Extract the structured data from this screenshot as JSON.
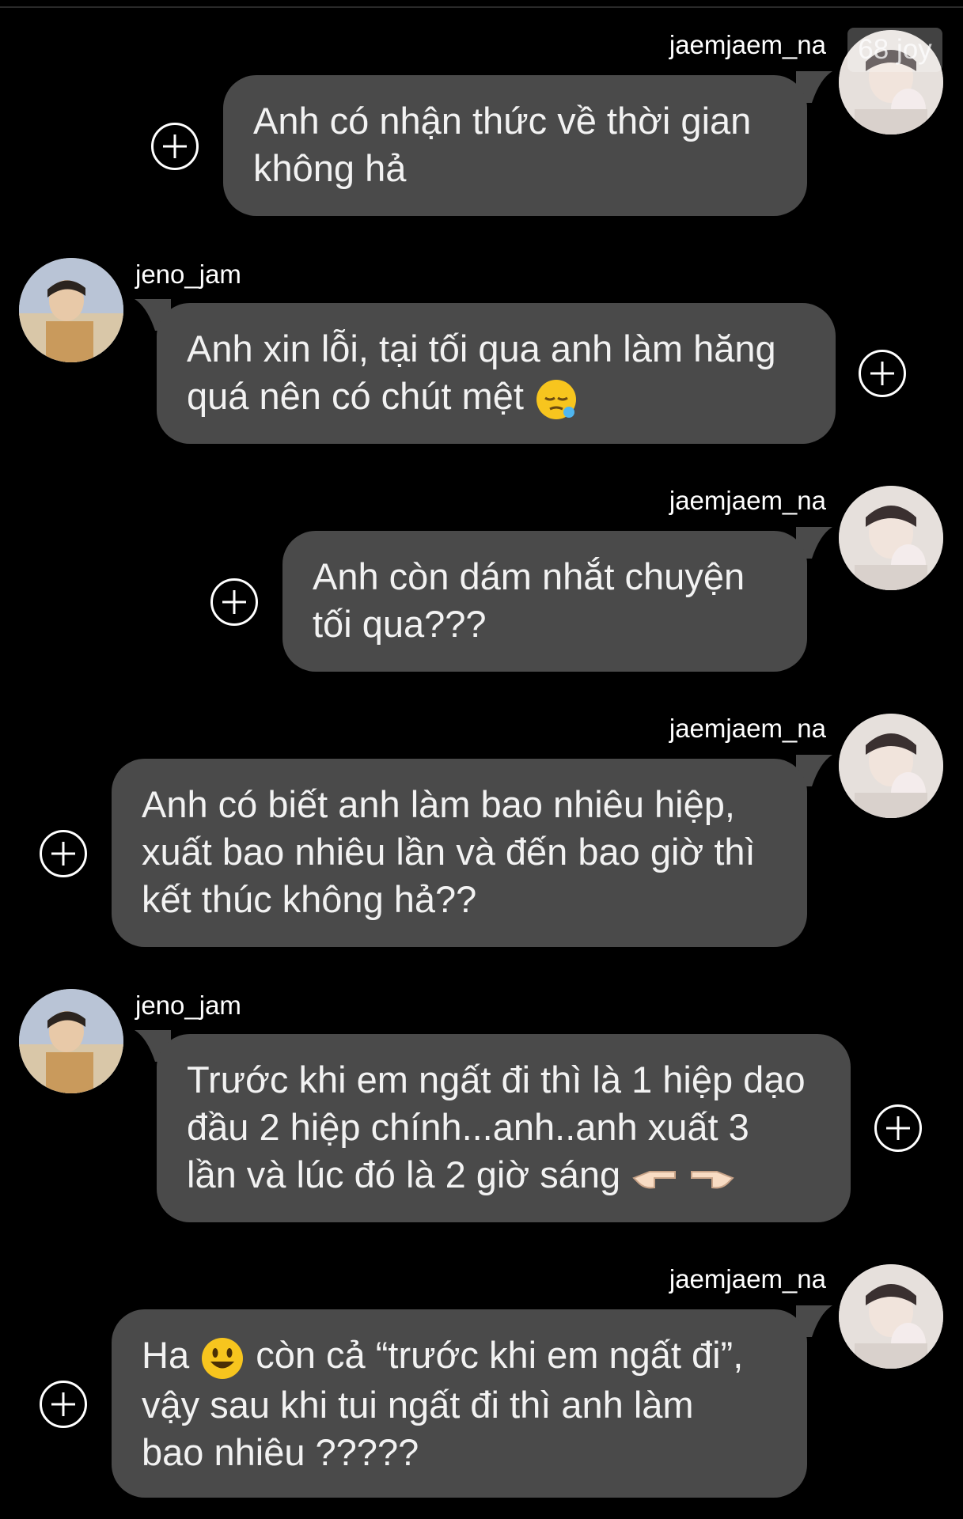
{
  "watermark": "68 joy",
  "messages": [
    {
      "sender": "jaemjaem_na",
      "side": "right",
      "lines": [
        "Anh có nhận thức về thời gian",
        "không hả"
      ]
    },
    {
      "sender": "jeno_jam",
      "side": "left",
      "lines": [
        "Anh xin lỗi, tại tối qua anh làm hăng",
        "quá nên có chút mệt"
      ],
      "emoji": [
        "sleepy-face"
      ]
    },
    {
      "sender": "jaemjaem_na",
      "side": "right",
      "lines": [
        "Anh còn dám nhắt chuyện",
        "tối qua???"
      ]
    },
    {
      "sender": "jaemjaem_na",
      "side": "right",
      "lines": [
        "Anh có biết anh làm bao nhiêu hiệp,",
        "xuất bao nhiêu lần và đến bao giờ thì",
        "kết thúc không hả??"
      ]
    },
    {
      "sender": "jeno_jam",
      "side": "left",
      "lines": [
        "Trước khi em ngất đi thì là 1 hiệp dạo",
        "đầu 2 hiệp chính...anh..anh xuất 3",
        "lần và lúc đó là 2 giờ sáng"
      ],
      "emoji": [
        "pointing-left",
        "pointing-right"
      ]
    },
    {
      "sender": "jaemjaem_na",
      "side": "right",
      "lines_parts": [
        "Ha",
        "còn cả “trước khi em ngất đi”,"
      ],
      "lines": [
        "vậy sau khi tui ngất đi thì anh làm",
        "bao nhiêu ?????"
      ],
      "emoji": [
        "smiling-face"
      ]
    }
  ],
  "colors": {
    "bubble": "#4a4a4a",
    "background": "#000000",
    "text": "#f2f2f2"
  }
}
